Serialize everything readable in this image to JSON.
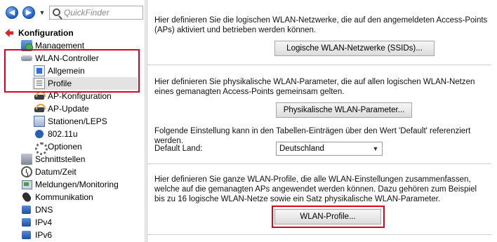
{
  "toolbar": {
    "back_glyph": "◀",
    "forward_glyph": "▶",
    "history_glyph": "▼",
    "search_placeholder": "QuickFinder"
  },
  "tree": {
    "konfiguration": "Konfiguration",
    "management": "Management",
    "wlan_controller": "WLAN-Controller",
    "allgemein": "Allgemein",
    "profile": "Profile",
    "ap_konfiguration": "AP-Konfiguration",
    "ap_update": "AP-Update",
    "stationen": "Stationen/LEPS",
    "ieee80211u": "802.11u",
    "optionen": "Optionen",
    "schnittstellen": "Schnittstellen",
    "datum_zeit": "Datum/Zeit",
    "meldungen": "Meldungen/Monitoring",
    "kommunikation": "Kommunikation",
    "dns": "DNS",
    "ipv4": "IPv4",
    "ipv6": "IPv6"
  },
  "main": {
    "section1_text": "Hier definieren Sie die logischen WLAN-Netzwerke, die auf den angemeldeten Access-Points (APs) aktiviert und betrieben werden können.",
    "ssid_button": "Logische WLAN-Netzwerke (SSIDs)...",
    "section2_text": "Hier definieren Sie physikalische WLAN-Parameter, die auf allen logischen WLAN-Netzen eines gemanagten Access-Points gemeinsam gelten.",
    "phys_button": "Physikalische WLAN-Parameter...",
    "default_note": "Folgende Einstellung kann in den Tabellen-Einträgen über den Wert 'Default' referenziert werden.",
    "default_land_label": "Default Land:",
    "default_land_value": "Deutschland",
    "section3_text": "Hier definieren Sie ganze WLAN-Profile, die alle WLAN-Einstellungen zusammenfassen, welche auf die gemanagten APs angewendet werden können. Dazu gehören zum Beispiel bis zu 16 logische WLAN-Netze sowie ein Satz physikalische WLAN-Parameter.",
    "profiles_button": "WLAN-Profile..."
  },
  "colors": {
    "highlight": "#e0001b",
    "selection": "#e3e3e3"
  }
}
